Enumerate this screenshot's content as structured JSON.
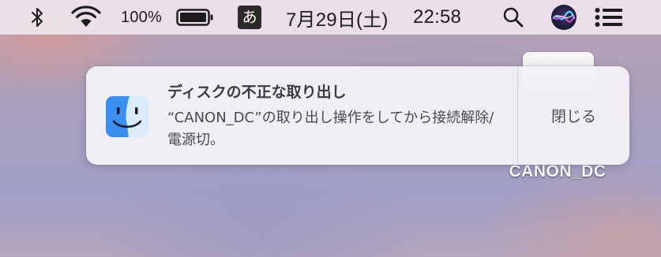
{
  "menubar": {
    "bluetooth_icon": "bluetooth-icon",
    "wifi_icon": "wifi-icon",
    "battery_percent": "100%",
    "battery_icon": "battery-full-icon",
    "battery_level": 1.0,
    "input_method": "あ",
    "date": "7月29日(土)",
    "time": "22:58",
    "spotlight_icon": "search-icon",
    "siri_icon": "siri-icon",
    "notification_center_icon": "list-icon"
  },
  "desktop": {
    "drive_label": "CANON_DC"
  },
  "notification": {
    "app_icon": "finder-icon",
    "title": "ディスクの不正な取り出し",
    "body": "“CANON_DC”の取り出し操作をしてから接続解除/電源切。",
    "close_label": "閉じる"
  },
  "colors": {
    "menubar_bg": "#eee4ec",
    "notification_bg": "#f3f1f6",
    "ime_box": "#2e2a2c",
    "finder_blue": "#3a8ff0"
  }
}
